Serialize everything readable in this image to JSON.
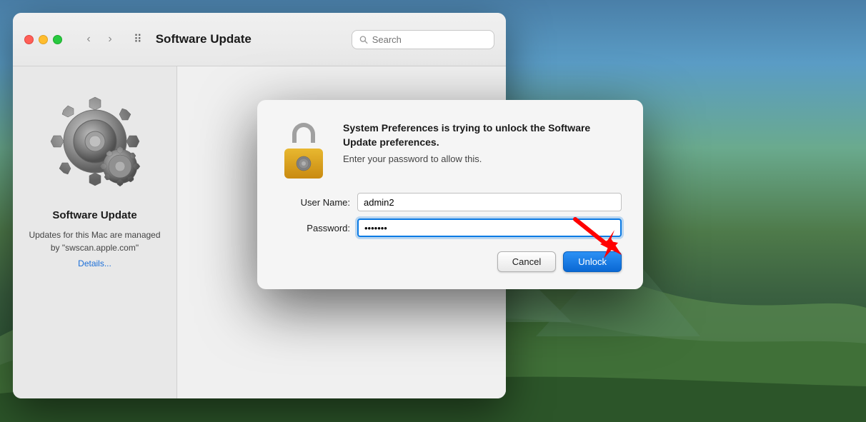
{
  "background": {
    "colors": [
      "#4a7fa8",
      "#5a9cc5",
      "#6aaa8e",
      "#4e7a4a",
      "#3a6040"
    ]
  },
  "main_window": {
    "title_bar": {
      "title": "Software Update",
      "search_placeholder": "Search",
      "traffic_lights": [
        "close",
        "minimize",
        "maximize"
      ],
      "back_arrow": "‹",
      "forward_arrow": "›",
      "grid_icon": "⠿"
    },
    "sidebar": {
      "app_name": "Software Update",
      "description": "Updates for this Mac are managed by \"swscan.apple.com\"",
      "link_text": "Details..."
    }
  },
  "auth_dialog": {
    "heading": "System Preferences is trying to unlock the Software Update preferences.",
    "subtext": "Enter your password to allow this.",
    "fields": {
      "username_label": "User Name:",
      "username_value": "admin2",
      "password_label": "Password:",
      "password_value": "•••••••"
    },
    "buttons": {
      "cancel": "Cancel",
      "unlock": "Unlock"
    }
  }
}
